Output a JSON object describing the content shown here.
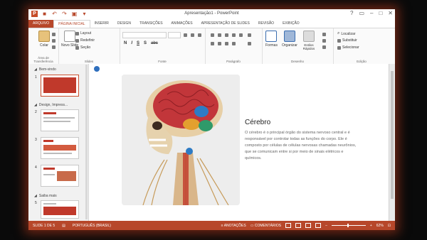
{
  "window": {
    "title": "Apresentação1 - PowerPoint"
  },
  "qat": {
    "save_icon": "save-icon",
    "undo_icon": "undo-icon",
    "redo_icon": "redo-icon",
    "present_icon": "present-icon"
  },
  "tabs": [
    {
      "label": "ARQUIVO"
    },
    {
      "label": "PÁGINA INICIAL"
    },
    {
      "label": "INSERIR"
    },
    {
      "label": "DESIGN"
    },
    {
      "label": "TRANSIÇÕES"
    },
    {
      "label": "ANIMAÇÕES"
    },
    {
      "label": "APRESENTAÇÃO DE SLIDES"
    },
    {
      "label": "REVISÃO"
    },
    {
      "label": "EXIBIÇÃO"
    }
  ],
  "ribbon": {
    "clipboard": {
      "paste": "Colar",
      "group": "Área de Transferência"
    },
    "slides": {
      "new_slide": "Novo Slide",
      "layout": "Layout",
      "reset": "Redefinir",
      "section": "Seção",
      "group": "Slides"
    },
    "font": {
      "bold": "N",
      "italic": "I",
      "underline": "S",
      "strike": "S",
      "abc": "abc",
      "group": "Fonte"
    },
    "paragraph": {
      "group": "Parágrafo"
    },
    "drawing": {
      "shapes": "Formas",
      "arrange": "Organizar",
      "quick_styles": "Estilos Rápidos",
      "group": "Desenho"
    },
    "editing": {
      "find": "Localizar",
      "replace": "Substituir",
      "select": "Selecionar",
      "group": "Edição"
    }
  },
  "sections": [
    {
      "title": "Bem-vindo"
    },
    {
      "title": "Design, Impress..."
    },
    {
      "title": "Saiba mais"
    }
  ],
  "slide_numbers": [
    "1",
    "2",
    "3",
    "4",
    "5"
  ],
  "slide": {
    "heading": "Cérebro",
    "body": "O cérebro é o principal órgão do sistema nervoso central e é responsável por controlar todas as funções do corpo. Ele é composto por células de células nervosas chamadas neurônios, que se comunicam entre si por meio de sinais elétricos e químicos."
  },
  "status": {
    "slide_info": "SLIDE 1 DE 5",
    "language": "PORTUGUÊS (BRASIL)",
    "notes": "ANOTAÇÕES",
    "comments": "COMENTÁRIOS",
    "zoom": "62%"
  },
  "colors": {
    "accent": "#b7472a",
    "window_glow": "#be3c1e"
  }
}
